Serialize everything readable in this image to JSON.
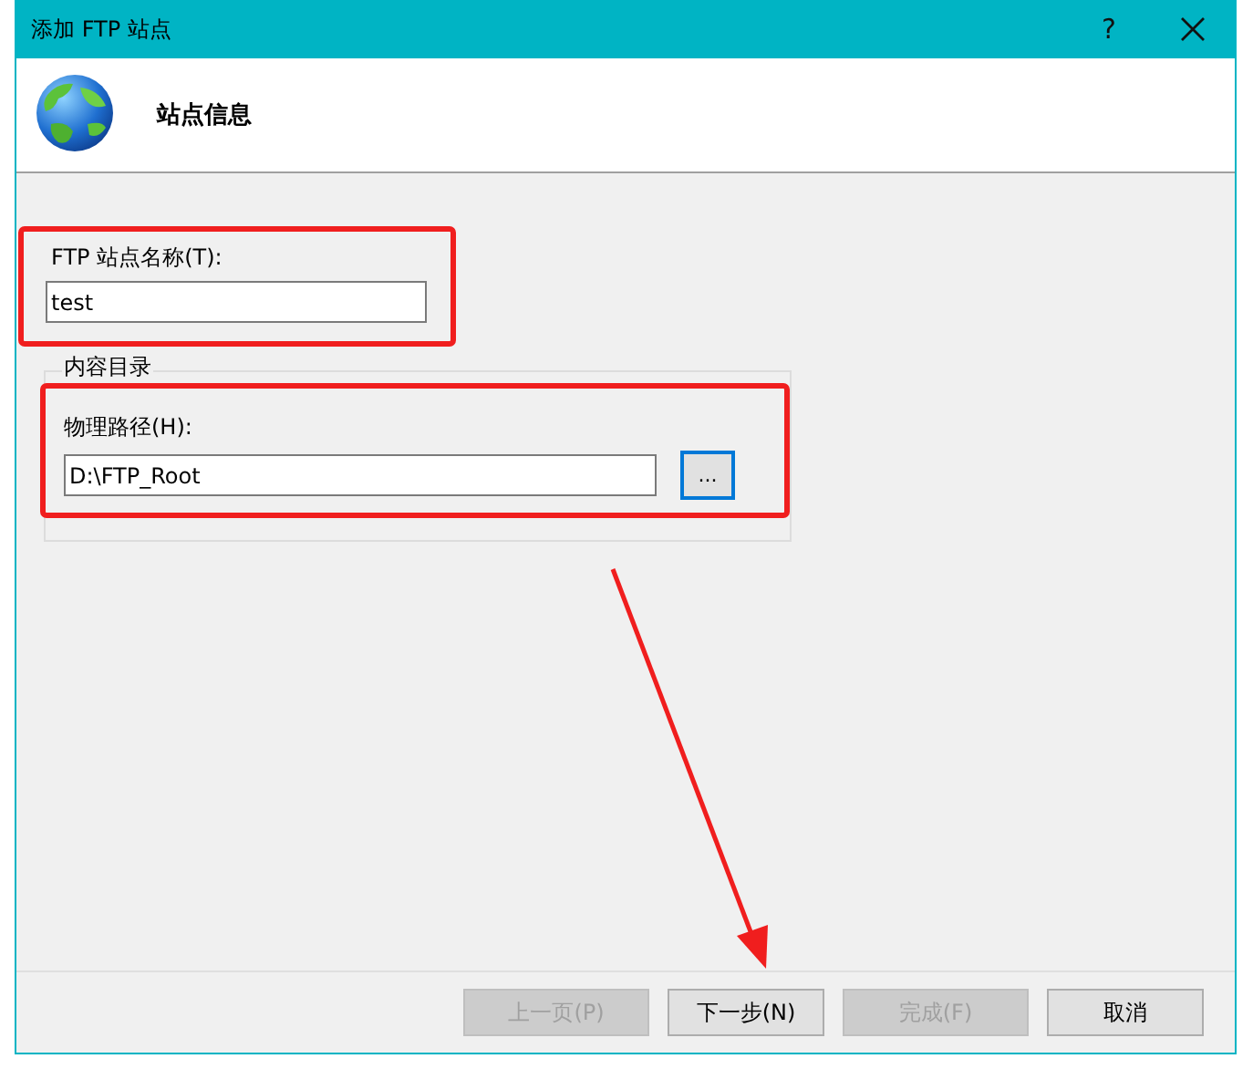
{
  "window": {
    "title": "添加 FTP 站点",
    "help": "?"
  },
  "header": {
    "title": "站点信息"
  },
  "name_field": {
    "label": "FTP 站点名称(T):",
    "value": "test"
  },
  "content_group": {
    "legend": "内容目录",
    "path_field": {
      "label": "物理路径(H):",
      "value": "D:\\FTP_Root"
    },
    "browse_button": "..."
  },
  "buttons": [
    {
      "label": "上一页(P)",
      "disabled": true
    },
    {
      "label": "下一步(N)",
      "disabled": false
    },
    {
      "label": "完成(F)",
      "disabled": true
    },
    {
      "label": "取消",
      "disabled": false
    }
  ]
}
